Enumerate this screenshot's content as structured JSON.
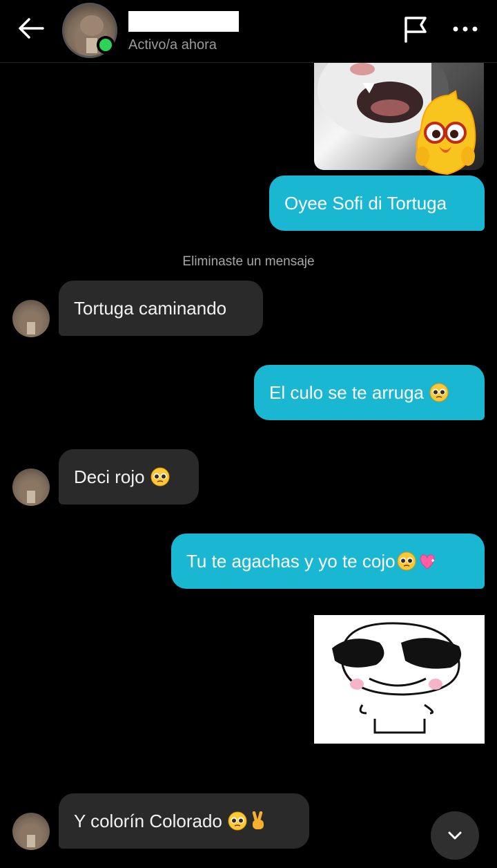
{
  "header": {
    "status": "Activo/a ahora"
  },
  "messages": {
    "m1": "Oyee Sofi di Tortuga",
    "system_note": "Eliminaste un mensaje",
    "m2": "Tortuga caminando",
    "m3": "El culo se te arruga",
    "m4": "Deci rojo",
    "m5": "Tu te agachas y yo te cojo",
    "m6": "Y colorín Colorado"
  },
  "colors": {
    "outgoing_bubble": "#19b7d2",
    "incoming_bubble": "#2a2a2a",
    "online_indicator": "#2bd456"
  },
  "icons": [
    "back-arrow-icon",
    "flag-icon",
    "more-icon",
    "pleading-face-emoji",
    "heart-emoji",
    "victory-hand-emoji",
    "chevron-down-icon"
  ]
}
